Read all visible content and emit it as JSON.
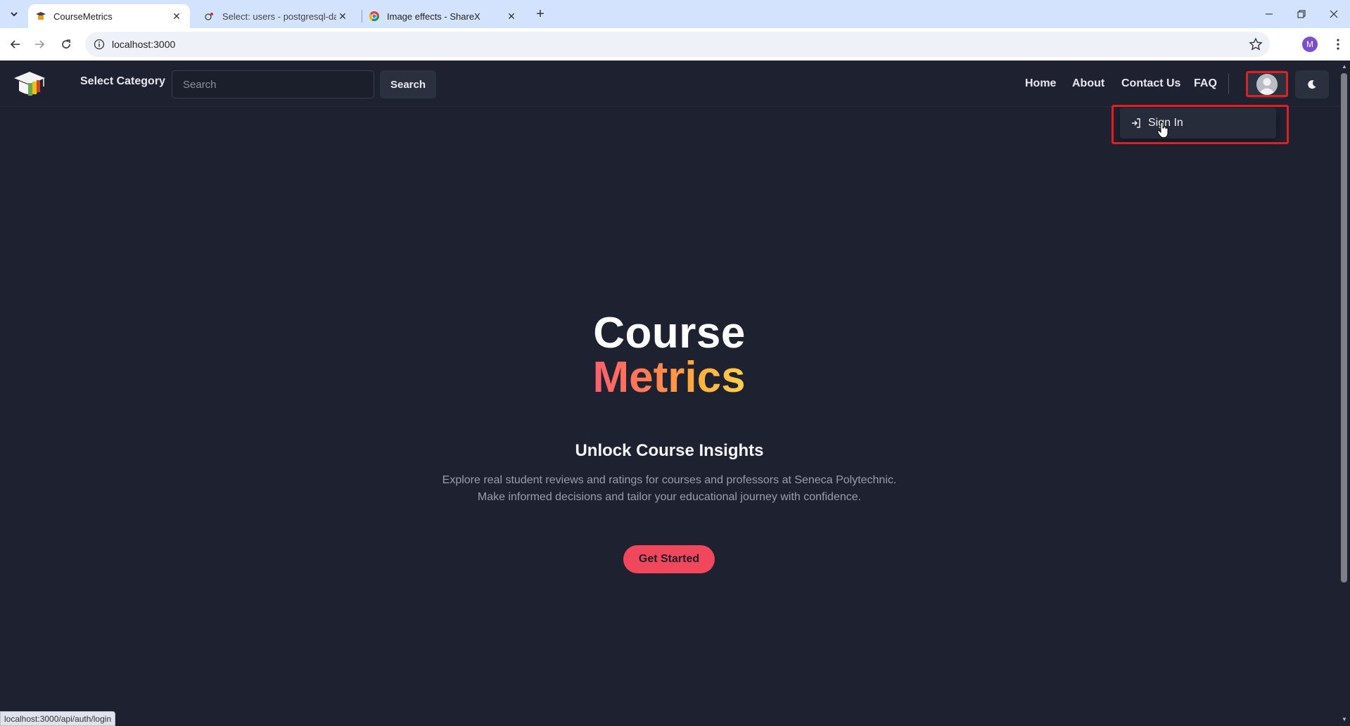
{
  "browser": {
    "tabs": [
      {
        "title": "CourseMetrics",
        "active": true
      },
      {
        "title": "Select: users - postgresql-datab",
        "active": false
      },
      {
        "title": "Image effects - ShareX",
        "active": false
      }
    ],
    "url": "localhost:3000",
    "profile_initial": "M",
    "status_url": "localhost:3000/api/auth/login"
  },
  "navbar": {
    "select_category": "Select Category",
    "search_placeholder": "Search",
    "search_button": "Search",
    "links": [
      "Home",
      "About",
      "Contact Us",
      "FAQ"
    ]
  },
  "dropdown": {
    "sign_in": "Sign In"
  },
  "hero": {
    "title_line1": "Course",
    "title_line2": "Metrics",
    "subtitle": "Unlock Course Insights",
    "description_line1": "Explore real student reviews and ratings for courses and professors at Seneca Polytechnic.",
    "description_line2": "Make informed decisions and tailor your educational journey with confidence.",
    "cta": "Get Started"
  },
  "colors": {
    "background": "#1d2130",
    "accent": "#f1475d",
    "highlight": "#e02020",
    "gradient_start": "#fb5d6e",
    "gradient_end": "#fbd44c"
  }
}
